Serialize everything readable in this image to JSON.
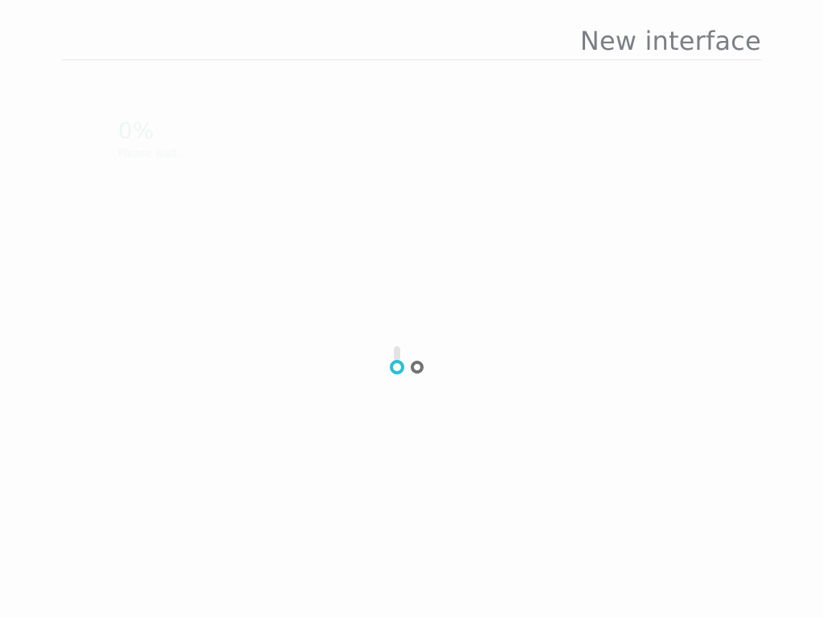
{
  "header": {
    "title": "New interface"
  },
  "progress": {
    "percent_text": "0%",
    "label": "Please wait...",
    "value": 0
  },
  "loader": {
    "icon": "loading-spinner-icon",
    "ring_colors": {
      "primary": "#2bbfd6",
      "secondary": "#727272"
    }
  },
  "colors": {
    "background": "#fdfdfd",
    "title_text": "#7b7f85",
    "divider": "#e6e6e6"
  }
}
